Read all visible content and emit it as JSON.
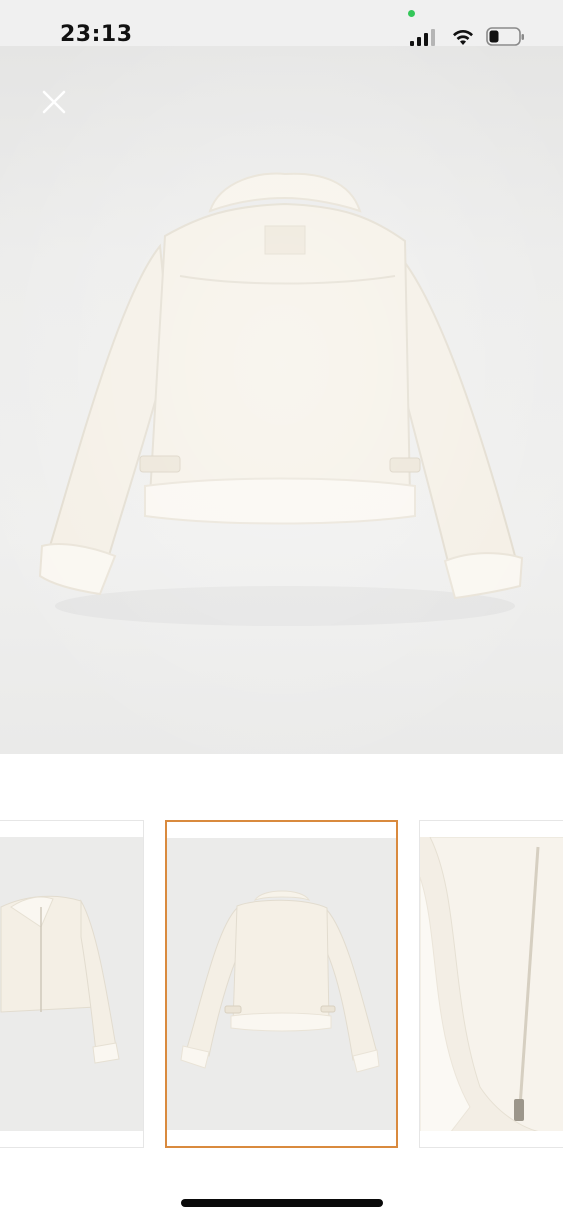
{
  "status_bar": {
    "time": "23:13",
    "icons": [
      "signal-icon",
      "wifi-icon",
      "battery-icon"
    ]
  },
  "viewer": {
    "close_icon": "close-icon",
    "selected_index": 2
  },
  "thumbnails": [
    {
      "name": "thumbnail-front-view"
    },
    {
      "name": "thumbnail-back-view"
    },
    {
      "name": "thumbnail-detail-zipper"
    }
  ],
  "colors": {
    "accent_border": "#d98a3e",
    "product": "#f4efe5"
  }
}
